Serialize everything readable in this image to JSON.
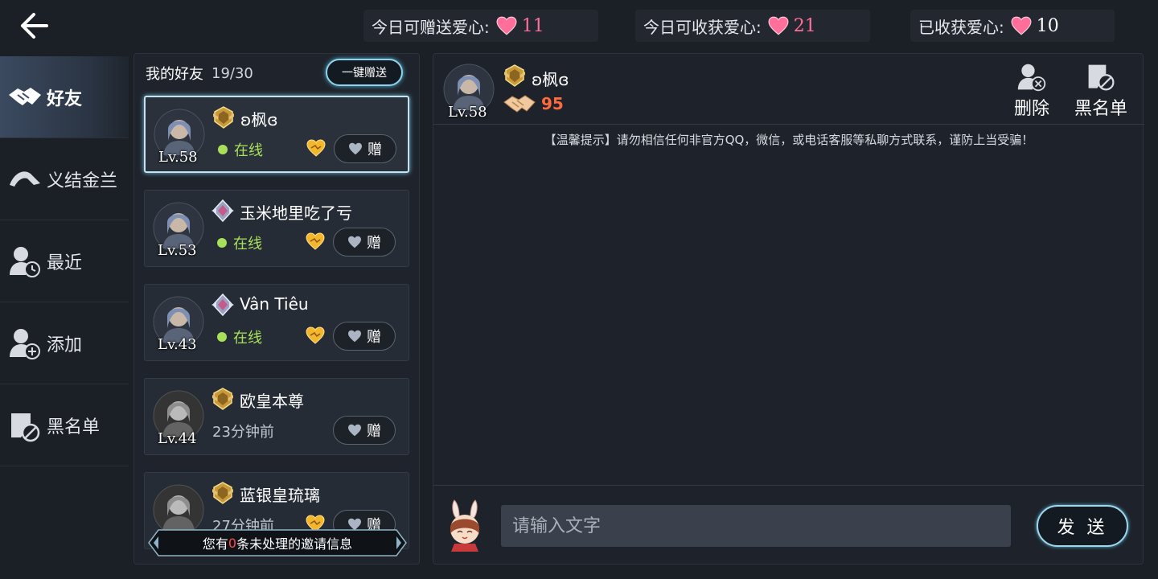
{
  "topbar": {
    "stats": [
      {
        "label": "今日可赠送爱心:",
        "value": "11"
      },
      {
        "label": "今日可收获爱心:",
        "value": "21"
      },
      {
        "label": "已收获爱心:",
        "value": "10"
      }
    ]
  },
  "sidebar": {
    "items": [
      {
        "label": "好友",
        "active": true,
        "icon": "handshake-icon"
      },
      {
        "label": "义结金兰",
        "active": false,
        "icon": "bow-icon"
      },
      {
        "label": "最近",
        "active": false,
        "icon": "user-clock-icon"
      },
      {
        "label": "添加",
        "active": false,
        "icon": "user-add-icon"
      },
      {
        "label": "黑名单",
        "active": false,
        "icon": "user-block-icon"
      }
    ]
  },
  "friend_list": {
    "title": "我的好友",
    "count": "19/30",
    "one_key_gift": "一键赠送",
    "friends": [
      {
        "name": "ʚ枫ɞ",
        "level": "Lv.58",
        "status": "在线",
        "online": true,
        "gift": "赠"
      },
      {
        "name": "玉米地里吃了亏",
        "level": "Lv.53",
        "status": "在线",
        "online": true,
        "gift": "赠"
      },
      {
        "name": "Vân Tiêu",
        "level": "Lv.43",
        "status": "在线",
        "online": true,
        "gift": "赠"
      },
      {
        "name": "欧皇本尊",
        "level": "Lv.44",
        "status": "23分钟前",
        "online": false,
        "gift": "赠"
      },
      {
        "name": "蓝银皇琉璃",
        "level": "",
        "status": "27分钟前",
        "online": false,
        "gift": "赠"
      }
    ],
    "invite": {
      "prefix": "您有",
      "count": "0",
      "suffix": "条未处理的邀请信息"
    }
  },
  "chat": {
    "friend_name": "ʚ枫ɞ",
    "friend_level": "Lv.58",
    "intimacy": "95",
    "delete_label": "删除",
    "block_label": "黑名单",
    "notice": "【温馨提示】请勿相信任何非官方QQ，微信，或电话客服等私聊方式联系，谨防上当受骗！",
    "input_placeholder": "请输入文字",
    "send_label": "发 送"
  },
  "colors": {
    "accent": "#9fd6ec",
    "online": "#a8e05a",
    "heart_pink": "#ff6f9a",
    "intimacy": "#ff6a3d"
  }
}
